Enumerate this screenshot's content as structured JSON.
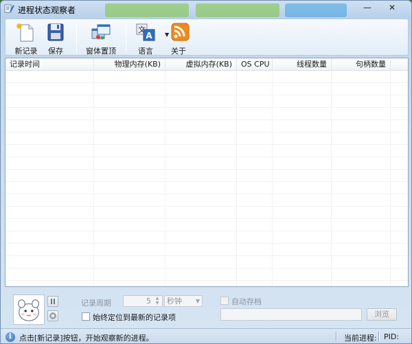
{
  "window": {
    "title": "进程状态观察者",
    "minimize_glyph": "—",
    "close_glyph": "✕"
  },
  "toolbar": {
    "items": [
      {
        "label": "新记录",
        "icon": "new-document-icon"
      },
      {
        "label": "保存",
        "icon": "floppy-save-icon"
      },
      {
        "label": "窗体置顶",
        "icon": "windows-topmost-icon"
      },
      {
        "label": "语言",
        "icon": "language-translate-icon"
      },
      {
        "label": "关于",
        "icon": "rss-about-icon"
      }
    ]
  },
  "table": {
    "columns": [
      {
        "label": "记录时间",
        "align": "left"
      },
      {
        "label": "物理内存(KB)",
        "align": "right"
      },
      {
        "label": "虚拟内存(KB)",
        "align": "right"
      },
      {
        "label": "OS CPU",
        "align": "right"
      },
      {
        "label": "线程数量",
        "align": "right"
      },
      {
        "label": "句柄数量",
        "align": "right"
      }
    ],
    "rows": []
  },
  "controls": {
    "period_label": "记录周期",
    "period_value": "5",
    "period_unit": "秒钟",
    "always_latest_label": "始终定位到最新的记录项",
    "auto_save_label": "自动存档",
    "browse_label": "浏览",
    "path_value": ""
  },
  "status": {
    "message": "点击[新记录]按钮，开始观察新的进程。",
    "current_process_label": "当前进程:",
    "pid_label": "PID:"
  },
  "colors": {
    "accent_blue": "#2f6fc0",
    "rss_orange": "#f08a1c"
  }
}
